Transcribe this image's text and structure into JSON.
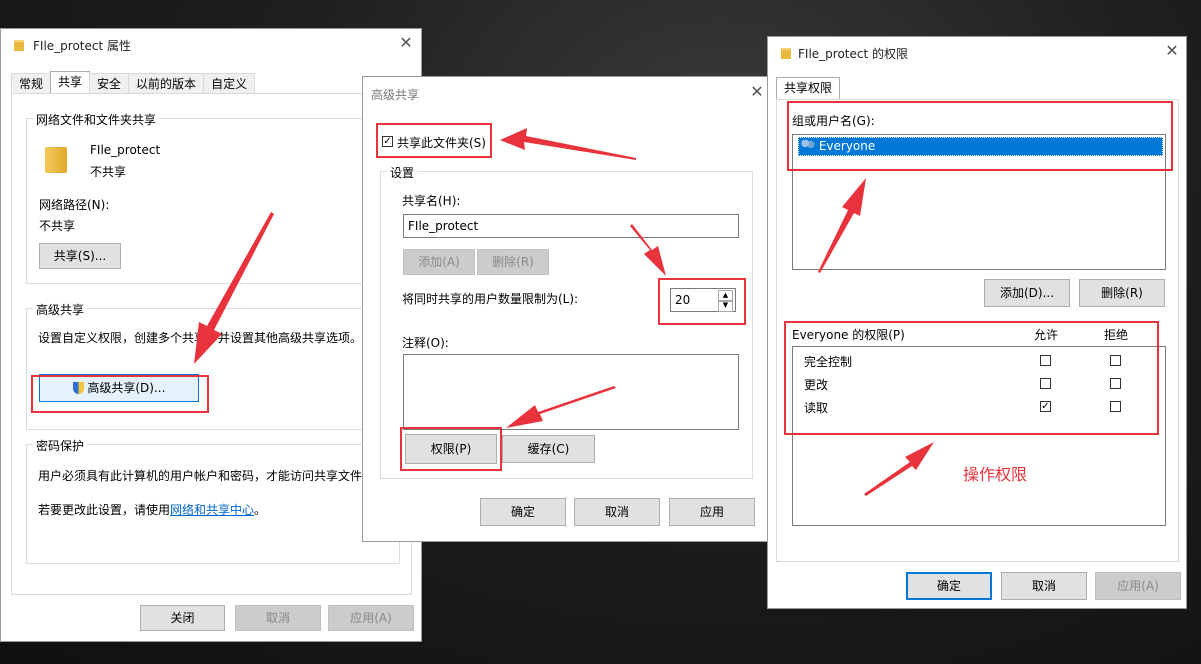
{
  "props_dialog": {
    "title": "FIle_protect 属性",
    "tabs": [
      "常规",
      "共享",
      "安全",
      "以前的版本",
      "自定义"
    ],
    "network_sharing_group": "网络文件和文件夹共享",
    "folder_name": "FIle_protect",
    "share_status": "不共享",
    "network_path_label": "网络路径(N):",
    "network_path_value": "不共享",
    "share_button": "共享(S)...",
    "advanced_group": "高级共享",
    "advanced_desc": "设置自定义权限，创建多个共享，并设置其他高级共享选项。",
    "advanced_button": "高级共享(D)...",
    "password_group": "密码保护",
    "password_desc": "用户必须具有此计算机的用户帐户和密码，才能访问共享文件夹。",
    "change_prefix": "若要更改此设置，请使用",
    "change_link": "网络和共享中心",
    "change_suffix": "。",
    "close_button": "关闭",
    "cancel_button": "取消",
    "apply_button": "应用(A)"
  },
  "adv_dialog": {
    "title": "高级共享",
    "share_checkbox": "共享此文件夹(S)",
    "share_checked": true,
    "settings_group": "设置",
    "share_name_label": "共享名(H):",
    "share_name_value": "FIle_protect",
    "add_button": "添加(A)",
    "remove_button": "删除(R)",
    "limit_label": "将同时共享的用户数量限制为(L):",
    "limit_value": "20",
    "comment_label": "注释(O):",
    "permissions_button": "权限(P)",
    "caching_button": "缓存(C)",
    "ok_button": "确定",
    "cancel_button": "取消",
    "apply_button": "应用"
  },
  "perm_dialog": {
    "title": "FIle_protect 的权限",
    "tab": "共享权限",
    "group_label": "组或用户名(G):",
    "users": [
      "Everyone"
    ],
    "add_button": "添加(D)...",
    "remove_button": "删除(R)",
    "perm_header": "Everyone 的权限(P)",
    "allow_header": "允许",
    "deny_header": "拒绝",
    "permissions": [
      {
        "name": "完全控制",
        "allow": false,
        "deny": false
      },
      {
        "name": "更改",
        "allow": false,
        "deny": false
      },
      {
        "name": "读取",
        "allow": true,
        "deny": false
      }
    ],
    "ok_button": "确定",
    "cancel_button": "取消",
    "apply_button": "应用(A)"
  },
  "annotation": {
    "text": "操作权限",
    "color": "#e8333c"
  }
}
